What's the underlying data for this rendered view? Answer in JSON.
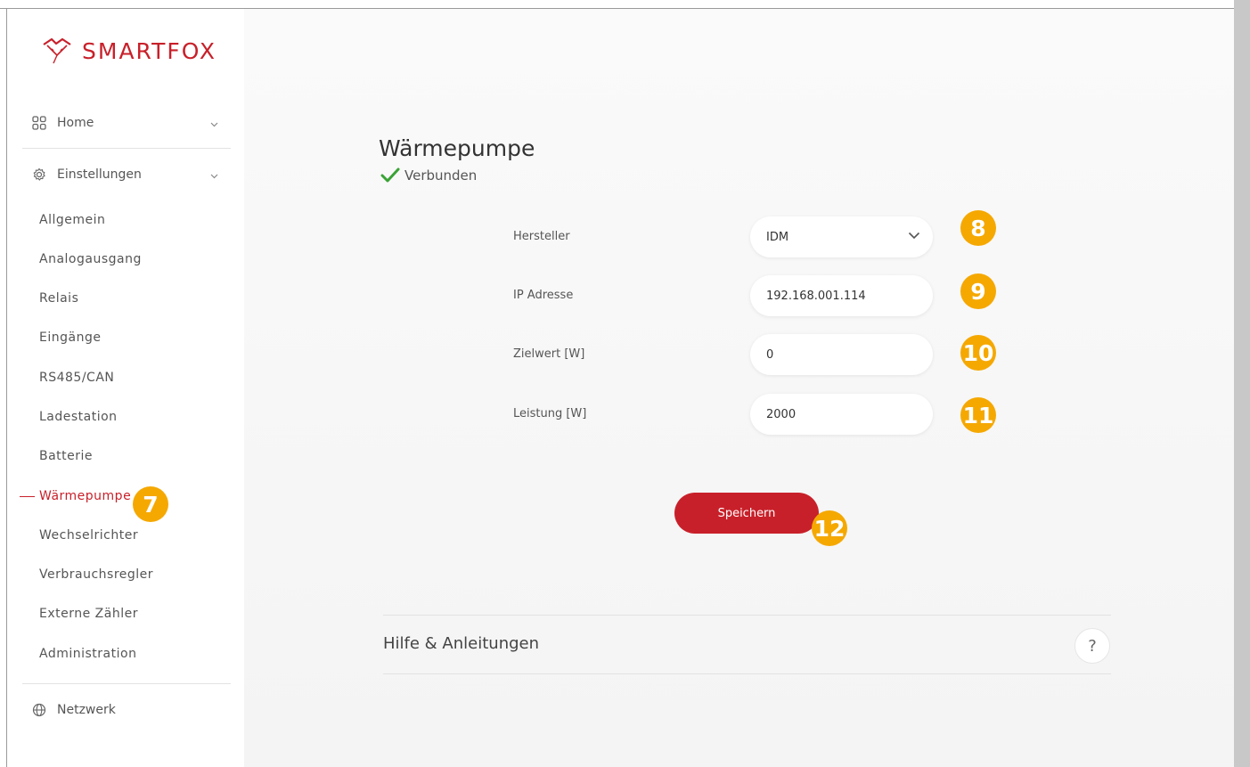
{
  "brand": {
    "name": "SMARTFOX",
    "color": "#c8202a"
  },
  "sidebar": {
    "home": {
      "label": "Home",
      "icon": "grid-icon"
    },
    "settings": {
      "label": "Einstellungen",
      "icon": "gear-icon"
    },
    "items": [
      {
        "label": "Allgemein"
      },
      {
        "label": "Analogausgang"
      },
      {
        "label": "Relais"
      },
      {
        "label": "Eingänge"
      },
      {
        "label": "RS485/CAN"
      },
      {
        "label": "Ladestation"
      },
      {
        "label": "Batterie"
      },
      {
        "label": "Wärmepumpe",
        "active": true
      },
      {
        "label": "Wechselrichter"
      },
      {
        "label": "Verbrauchsregler"
      },
      {
        "label": "Externe Zähler"
      },
      {
        "label": "Administration"
      }
    ],
    "network": {
      "label": "Netzwerk",
      "icon": "globe-icon"
    }
  },
  "page": {
    "title": "Wärmepumpe",
    "status": "Verbunden",
    "status_color": "#3aa335"
  },
  "form": {
    "manufacturer": {
      "label": "Hersteller",
      "value": "IDM"
    },
    "ip": {
      "label": "IP Adresse",
      "value": "192.168.001.114"
    },
    "target": {
      "label": "Zielwert [W]",
      "value": "0"
    },
    "power": {
      "label": "Leistung [W]",
      "value": "2000"
    },
    "save_label": "Speichern"
  },
  "annotations": {
    "b7": "7",
    "b8": "8",
    "b9": "9",
    "b10": "10",
    "b11": "11",
    "b12": "12",
    "color": "#f5a800"
  },
  "help": {
    "title": "Hilfe & Anleitungen",
    "button": "?"
  }
}
